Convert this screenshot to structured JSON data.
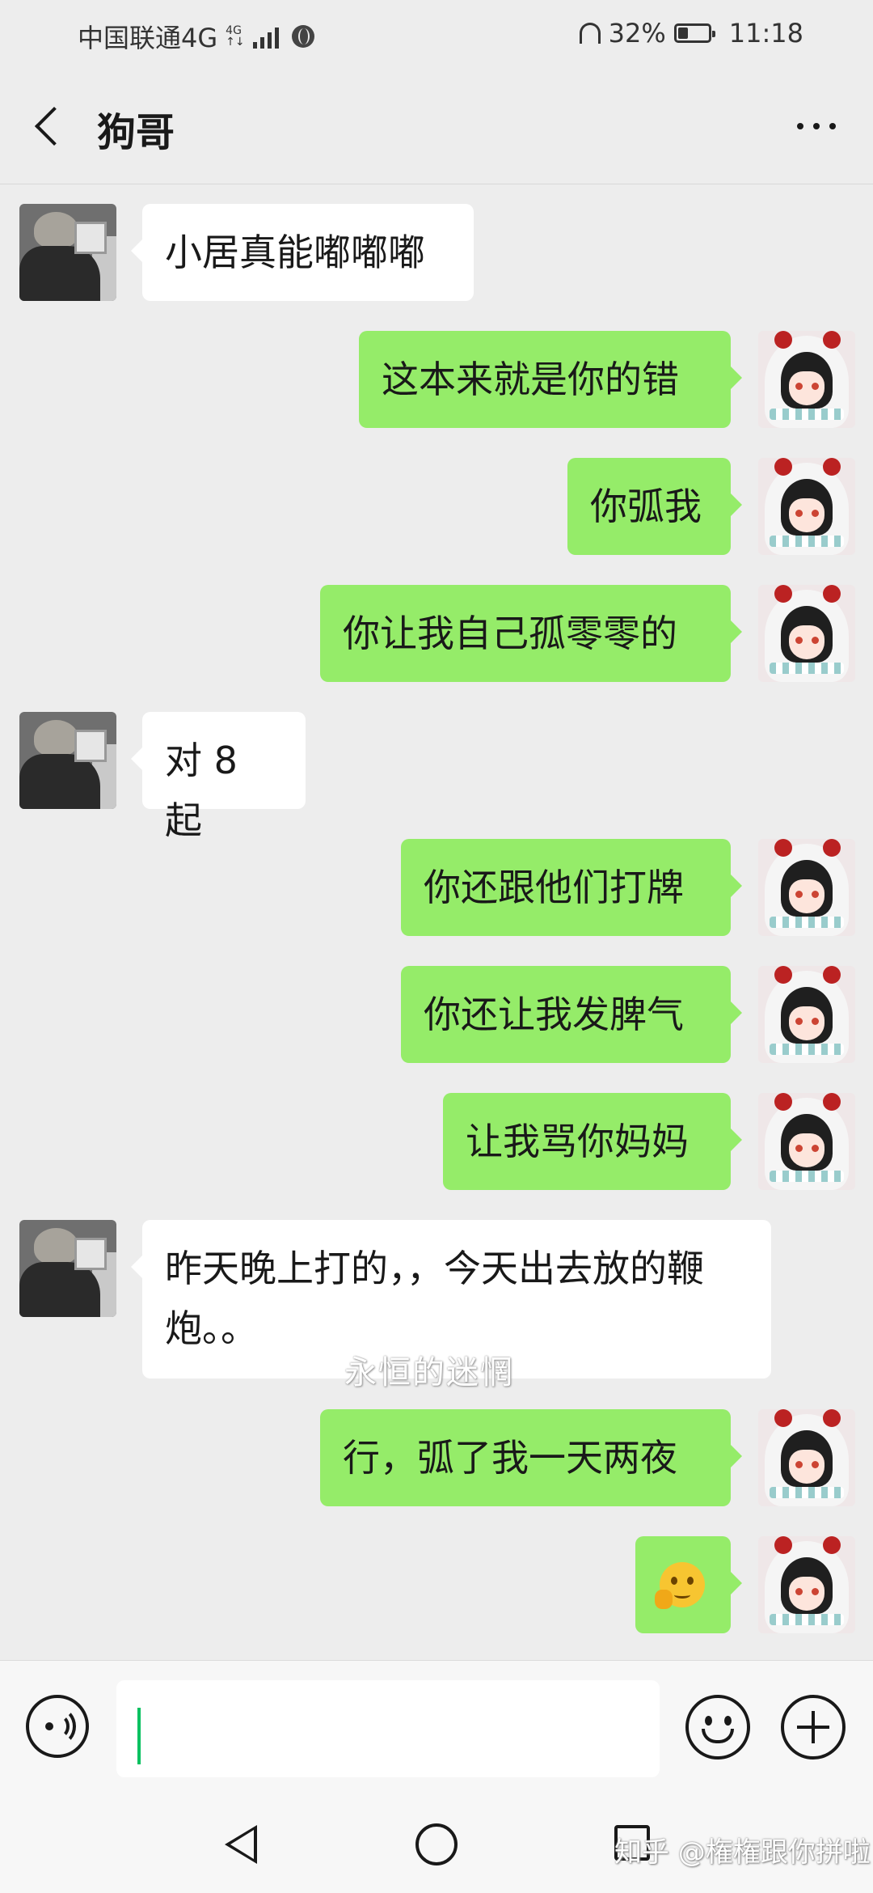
{
  "status_bar": {
    "carrier": "中国联通4G",
    "net_small_top": "4G",
    "net_small_bottom": "↑↓",
    "battery": "32%",
    "battery_level": 0.32,
    "time": "11:18"
  },
  "header": {
    "title": "狗哥"
  },
  "messages": [
    {
      "side": "left",
      "text": "小居真能嘟嘟嘟"
    },
    {
      "side": "right",
      "text": "这本来就是你的错"
    },
    {
      "side": "right",
      "text": "你弧我"
    },
    {
      "side": "right",
      "text": "你让我自己孤零零的"
    },
    {
      "side": "left",
      "text": "对 8 起"
    },
    {
      "side": "right",
      "text": "你还跟他们打牌"
    },
    {
      "side": "right",
      "text": "你还让我发脾气"
    },
    {
      "side": "right",
      "text": "让我骂你妈妈"
    },
    {
      "side": "left",
      "text": "昨天晚上打的，，今天出去放的鞭炮。。"
    },
    {
      "side": "right",
      "text": "行，弧了我一天两夜"
    },
    {
      "side": "right",
      "emoji": "thinking-face-emoji"
    }
  ],
  "overlay_caption": "永恒的迷惘",
  "input": {
    "value": ""
  },
  "watermark": "知乎 @権権跟你拼啦",
  "colors": {
    "background": "#ededed",
    "sent_bubble": "#95ec69",
    "received_bubble": "#ffffff",
    "caret": "#07c160"
  }
}
